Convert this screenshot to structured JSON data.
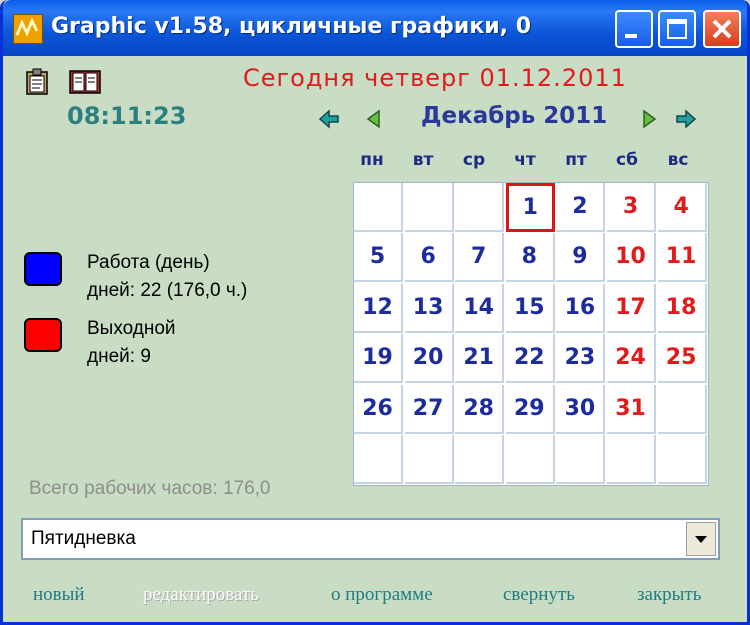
{
  "window": {
    "title": "Graphic v1.58, цикличные графики, 0"
  },
  "header": {
    "today_text": "Сегодня   четверг   01.12.2011",
    "clock": "08:11:23"
  },
  "calendar": {
    "month_title": "Декабрь 2011",
    "weekdays": [
      "пн",
      "вт",
      "ср",
      "чт",
      "пт",
      "сб",
      "вс"
    ],
    "weeks": [
      [
        {
          "d": "",
          "t": "work"
        },
        {
          "d": "",
          "t": "work"
        },
        {
          "d": "",
          "t": "work"
        },
        {
          "d": "1",
          "t": "work",
          "today": true
        },
        {
          "d": "2",
          "t": "work"
        },
        {
          "d": "3",
          "t": "off"
        },
        {
          "d": "4",
          "t": "off"
        }
      ],
      [
        {
          "d": "5",
          "t": "work"
        },
        {
          "d": "6",
          "t": "work"
        },
        {
          "d": "7",
          "t": "work"
        },
        {
          "d": "8",
          "t": "work"
        },
        {
          "d": "9",
          "t": "work"
        },
        {
          "d": "10",
          "t": "off"
        },
        {
          "d": "11",
          "t": "off"
        }
      ],
      [
        {
          "d": "12",
          "t": "work"
        },
        {
          "d": "13",
          "t": "work"
        },
        {
          "d": "14",
          "t": "work"
        },
        {
          "d": "15",
          "t": "work"
        },
        {
          "d": "16",
          "t": "work"
        },
        {
          "d": "17",
          "t": "off"
        },
        {
          "d": "18",
          "t": "off"
        }
      ],
      [
        {
          "d": "19",
          "t": "work"
        },
        {
          "d": "20",
          "t": "work"
        },
        {
          "d": "21",
          "t": "work"
        },
        {
          "d": "22",
          "t": "work"
        },
        {
          "d": "23",
          "t": "work"
        },
        {
          "d": "24",
          "t": "off"
        },
        {
          "d": "25",
          "t": "off"
        }
      ],
      [
        {
          "d": "26",
          "t": "work"
        },
        {
          "d": "27",
          "t": "work"
        },
        {
          "d": "28",
          "t": "work"
        },
        {
          "d": "29",
          "t": "work"
        },
        {
          "d": "30",
          "t": "work"
        },
        {
          "d": "31",
          "t": "off"
        },
        {
          "d": "",
          "t": "work"
        }
      ],
      [
        {
          "d": "",
          "t": "work"
        },
        {
          "d": "",
          "t": "work"
        },
        {
          "d": "",
          "t": "work"
        },
        {
          "d": "",
          "t": "work"
        },
        {
          "d": "",
          "t": "work"
        },
        {
          "d": "",
          "t": "work"
        },
        {
          "d": "",
          "t": "work"
        }
      ]
    ]
  },
  "legend": {
    "work": {
      "label": "Работа (день)",
      "detail": "дней: 22 (176,0 ч.)",
      "color": "#0000ff"
    },
    "off": {
      "label": "Выходной",
      "detail": "дней: 9",
      "color": "#ff0000"
    }
  },
  "summary": {
    "total_hours": "Всего рабочих часов:  176,0"
  },
  "schedule_select": {
    "value": "Пятидневка"
  },
  "footer": {
    "new": "новый",
    "edit": "редактировать",
    "about": "о программе",
    "minimize": "свернуть",
    "close": "закрыть"
  },
  "colors": {
    "workday_text": "#1c2c9c",
    "dayoff_text": "#e11b1b",
    "today_border": "#d81818",
    "clock": "#2d8080",
    "links": "#1e7c84"
  },
  "icons": {
    "app": "app-graph-icon",
    "clipboard": "clipboard-icon",
    "book": "book-icon",
    "prev_year": "double-arrow-left-icon",
    "prev_month": "arrow-left-icon",
    "next_month": "arrow-right-icon",
    "next_year": "double-arrow-right-icon"
  }
}
